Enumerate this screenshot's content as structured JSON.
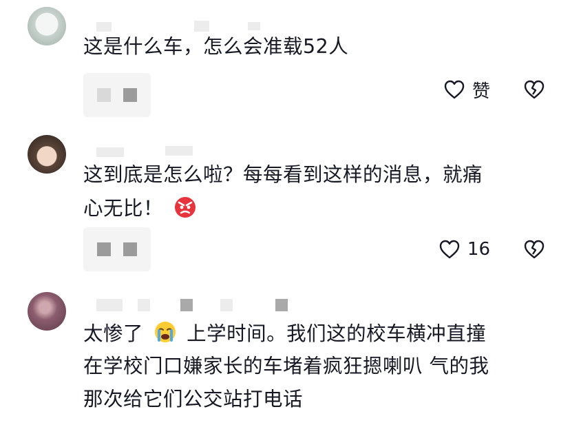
{
  "comments": [
    {
      "text": "这是什么车，怎么会准载52人",
      "like_label": "赞"
    },
    {
      "text_line1": "这到底是怎么啦？每每看到这样的消息，就痛",
      "text_line2": "心无比！",
      "emoji": "angry-face-emoji",
      "like_label": "16"
    },
    {
      "text_line1_a": "太惨了",
      "emoji": "crying-face-emoji",
      "text_line1_b": "上学时间。我们这的校车横冲直撞",
      "text_line2": "在学校门口嫌家长的车堵着疯狂摁喇叭 气的我",
      "text_line3": "那次给它们公交站打电话"
    }
  ],
  "icons": {
    "like": "heart-outline-icon",
    "dislike": "broken-heart-icon"
  }
}
